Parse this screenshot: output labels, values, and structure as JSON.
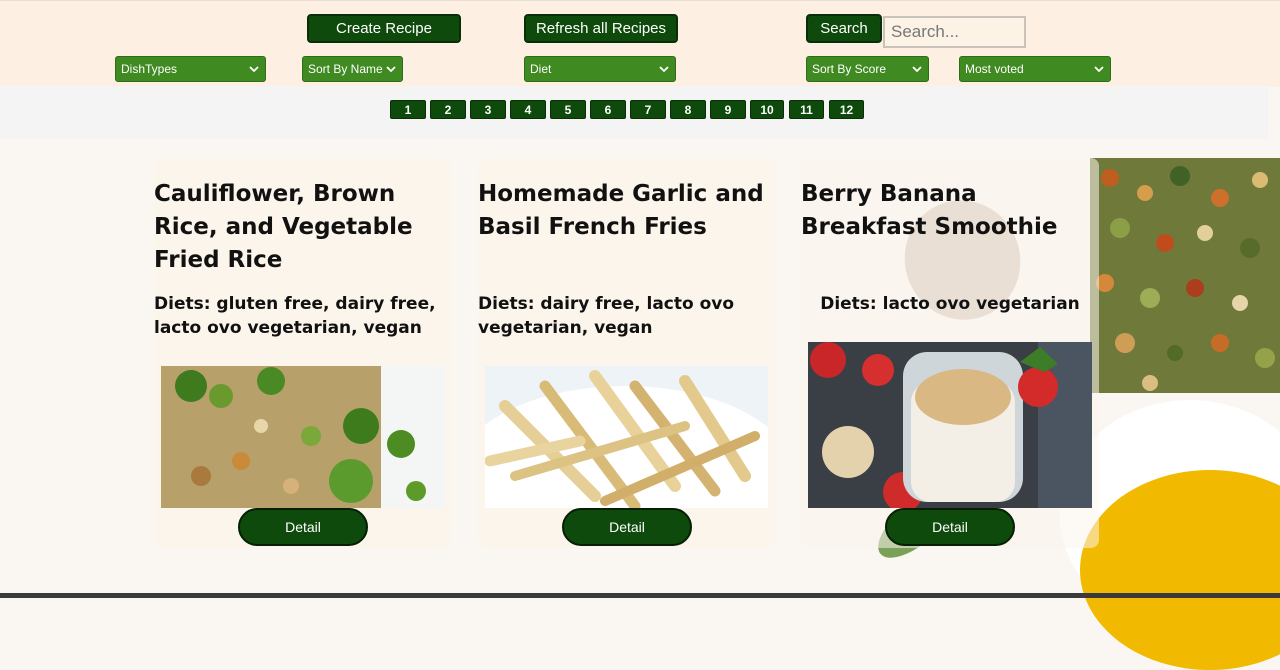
{
  "toolbar": {
    "create_label": "Create Recipe",
    "refresh_label": "Refresh all Recipes",
    "search_label": "Search",
    "search_placeholder": "Search..."
  },
  "filters": {
    "dish_types": "DishTypes",
    "sort_by_name": "Sort By Name",
    "diet": "Diet",
    "sort_by_score": "Sort By Score",
    "most_voted": "Most voted"
  },
  "pagination": [
    "1",
    "2",
    "3",
    "4",
    "5",
    "6",
    "7",
    "8",
    "9",
    "10",
    "11",
    "12"
  ],
  "recipes": [
    {
      "title": "Cauliflower, Brown Rice, and Vegetable Fried Rice",
      "diets": "Diets: gluten free, dairy free, lacto ovo vegetarian, vegan",
      "image": "fried-rice-image"
    },
    {
      "title": "Homemade Garlic and Basil French Fries",
      "diets": "Diets: dairy free, lacto ovo vegetarian, vegan",
      "image": "french-fries-image"
    },
    {
      "title": "Berry Banana Breakfast Smoothie",
      "diets": "Diets: lacto ovo vegetarian",
      "image": "smoothie-image"
    }
  ],
  "detail_label": "Detail",
  "colors": {
    "topbar_bg": "#fdf0e2",
    "dark_green": "#0e4a0b",
    "select_green": "#3f8a21",
    "card_bg": "#fcf4ec"
  }
}
